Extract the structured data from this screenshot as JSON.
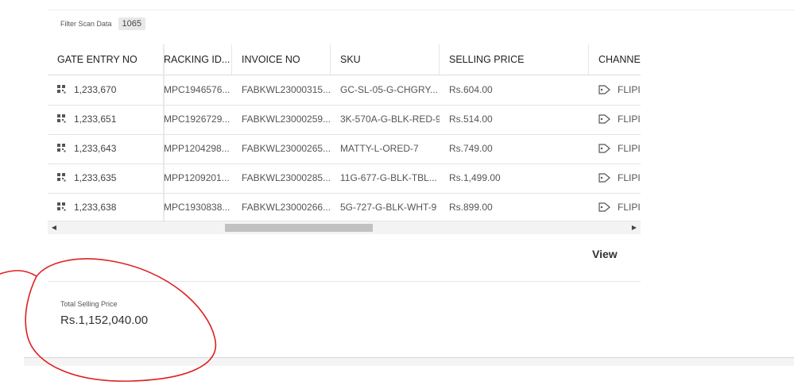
{
  "filter": {
    "label": "Filter Scan Data",
    "count": "1065"
  },
  "table": {
    "columns": [
      "GATE ENTRY NO",
      "RACKING ID...",
      "INVOICE NO",
      "SKU",
      "SELLING PRICE",
      "CHANNEL"
    ],
    "rows": [
      [
        "1,233,670",
        "MPC1946576...",
        "FABKWL23000315...",
        "GC-SL-05-G-CHGRY...",
        "Rs.604.00",
        "FLIPI"
      ],
      [
        "1,233,651",
        "MPC1926729...",
        "FABKWL23000259...",
        "3K-570A-G-BLK-RED-9",
        "Rs.514.00",
        "FLIPI"
      ],
      [
        "1,233,643",
        "MPP1204298...",
        "FABKWL23000265...",
        "MATTY-L-ORED-7",
        "Rs.749.00",
        "FLIPI"
      ],
      [
        "1,233,635",
        "MPP1209201...",
        "FABKWL23000285...",
        "11G-677-G-BLK-TBL...",
        "Rs.1,499.00",
        "FLIPI"
      ],
      [
        "1,233,638",
        "MPC1930838...",
        "FABKWL23000266...",
        "5G-727-G-BLK-WHT-9",
        "Rs.899.00",
        "FLIPI"
      ]
    ],
    "row_icon": "qr-grid-icon",
    "channel_icon": "tag-icon"
  },
  "view_label": "View",
  "total": {
    "label": "Total Selling Price",
    "value": "Rs.1,152,040.00"
  },
  "colors": {
    "annotation": "#e02020",
    "scroll_thumb": "#c1c1c1"
  }
}
